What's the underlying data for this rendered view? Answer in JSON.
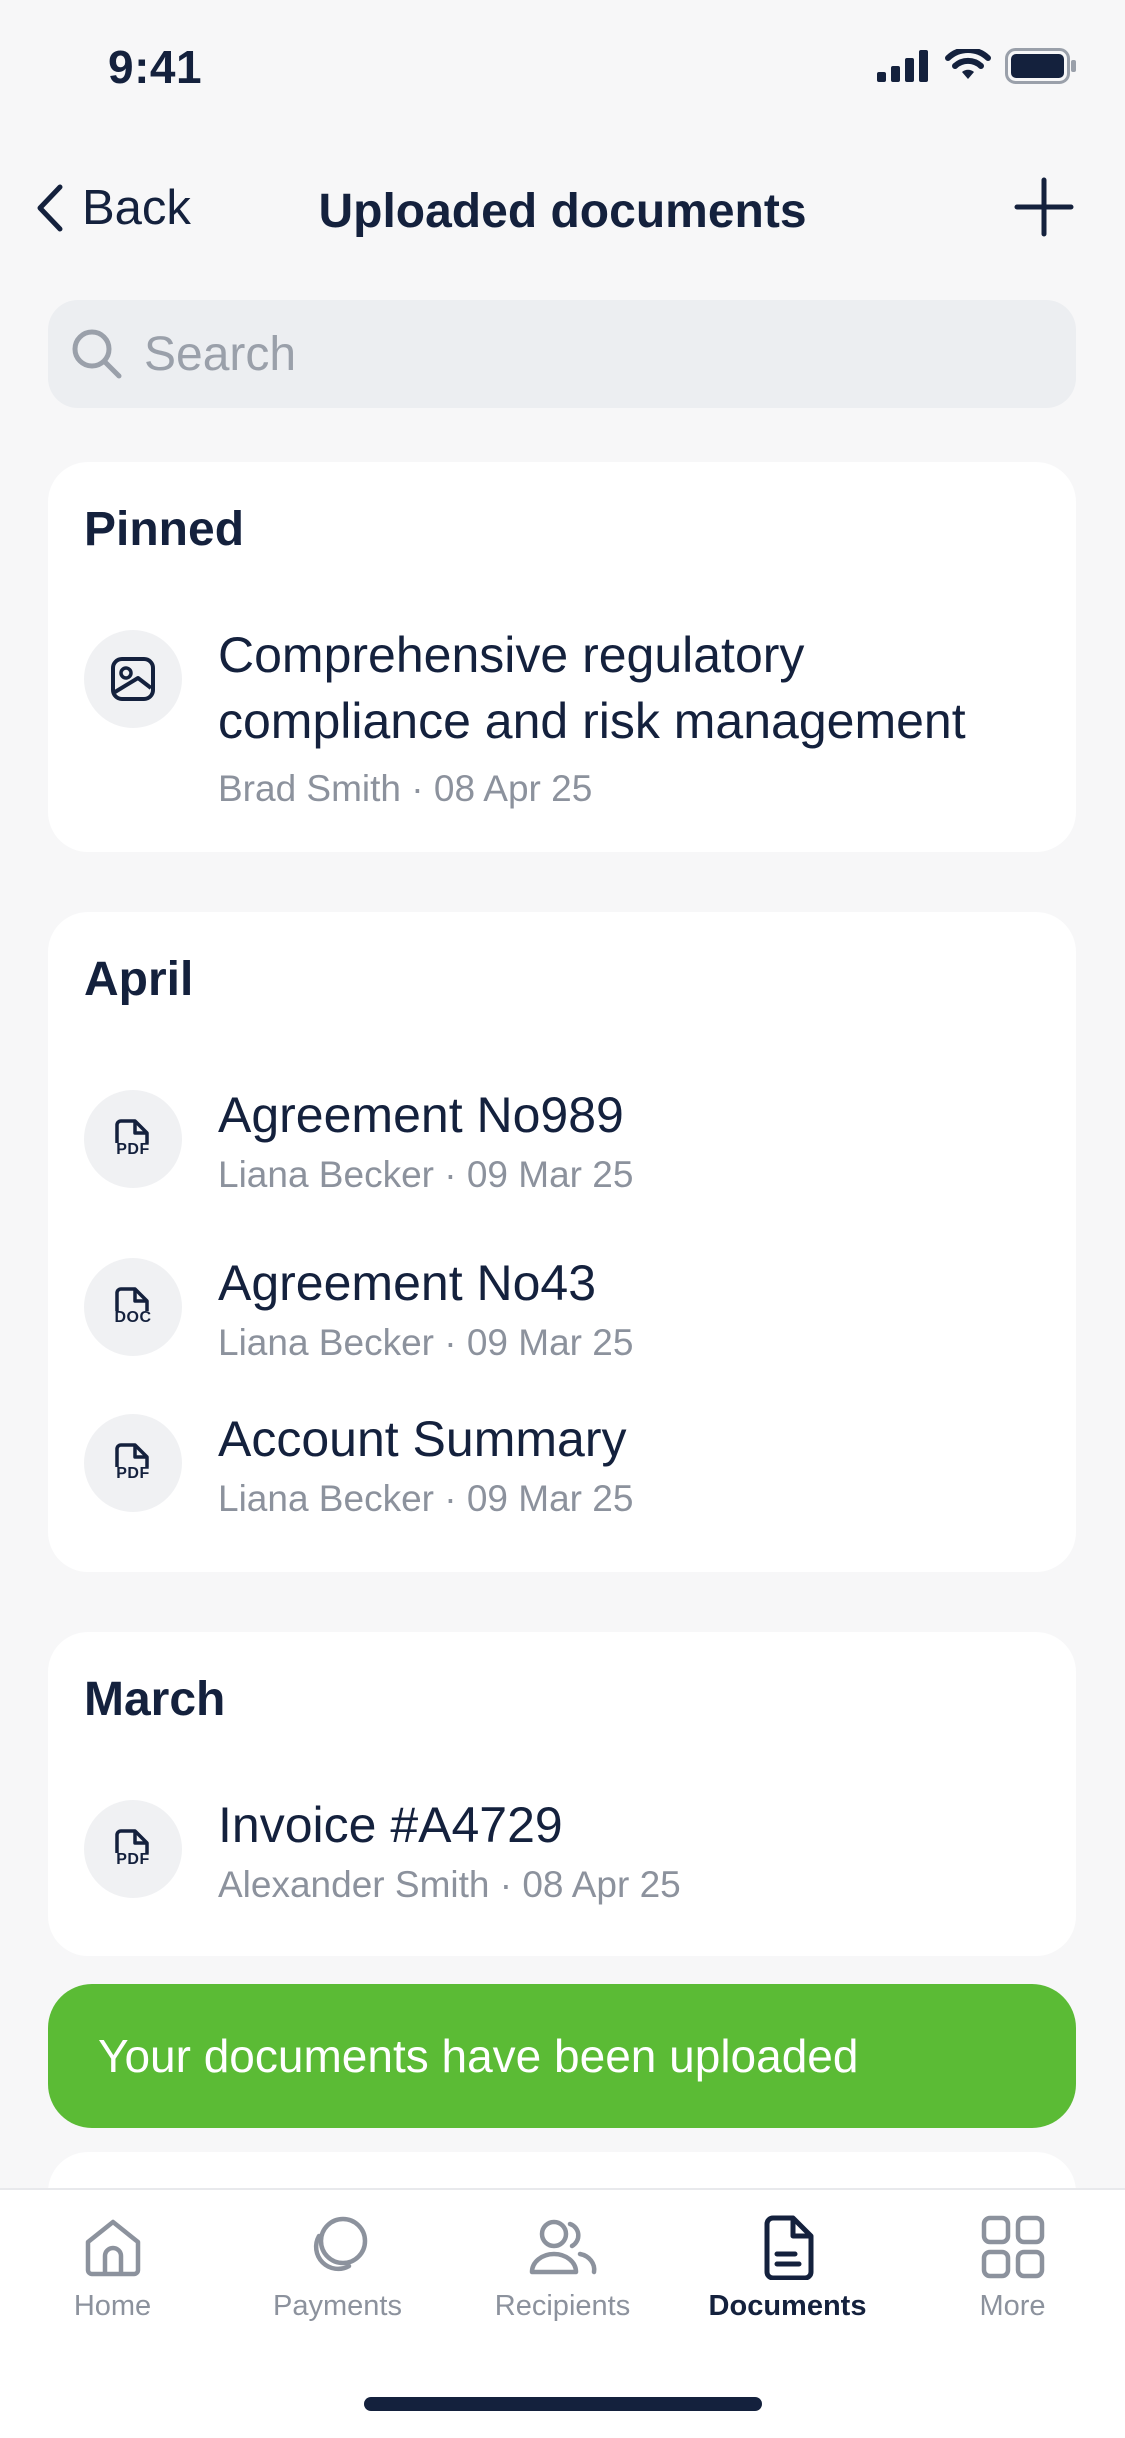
{
  "status_bar": {
    "time": "9:41"
  },
  "nav": {
    "back_label": "Back",
    "title": "Uploaded documents"
  },
  "search": {
    "placeholder": "Search",
    "value": ""
  },
  "sections": {
    "pinned": {
      "title": "Pinned",
      "items": [
        {
          "title_line1": "Comprehensive regulatory",
          "title_line2": "compliance and risk management",
          "meta": "Brad Smith · 08 Apr 25",
          "icon": "image-icon"
        }
      ]
    },
    "april": {
      "title": "April",
      "items": [
        {
          "title": "Agreement No989",
          "meta": "Liana Becker · 09 Mar 25",
          "ext": "PDF",
          "icon": "pdf-file-icon"
        },
        {
          "title": "Agreement No43",
          "meta": "Liana Becker · 09 Mar 25",
          "ext": "DOC",
          "icon": "doc-file-icon"
        },
        {
          "title": "Account Summary",
          "meta": "Liana Becker · 09 Mar 25",
          "ext": "PDF",
          "icon": "pdf-file-icon"
        }
      ]
    },
    "march": {
      "title": "March",
      "items": [
        {
          "title": "Invoice #A4729",
          "meta": "Alexander Smith · 08 Apr 25",
          "ext": "PDF",
          "icon": "pdf-file-icon"
        }
      ]
    }
  },
  "toast": {
    "message": "Your documents have been uploaded",
    "color": "#5bbb35"
  },
  "tabbar": {
    "tabs": [
      {
        "label": "Home",
        "icon": "home-icon"
      },
      {
        "label": "Payments",
        "icon": "payments-icon"
      },
      {
        "label": "Recipients",
        "icon": "recipients-icon"
      },
      {
        "label": "Documents",
        "icon": "documents-icon",
        "active": true
      },
      {
        "label": "More",
        "icon": "grid-icon"
      }
    ]
  },
  "colors": {
    "primary_text": "#14213d",
    "secondary_text": "#8c929d",
    "background": "#f7f7f8",
    "card": "#ffffff"
  }
}
